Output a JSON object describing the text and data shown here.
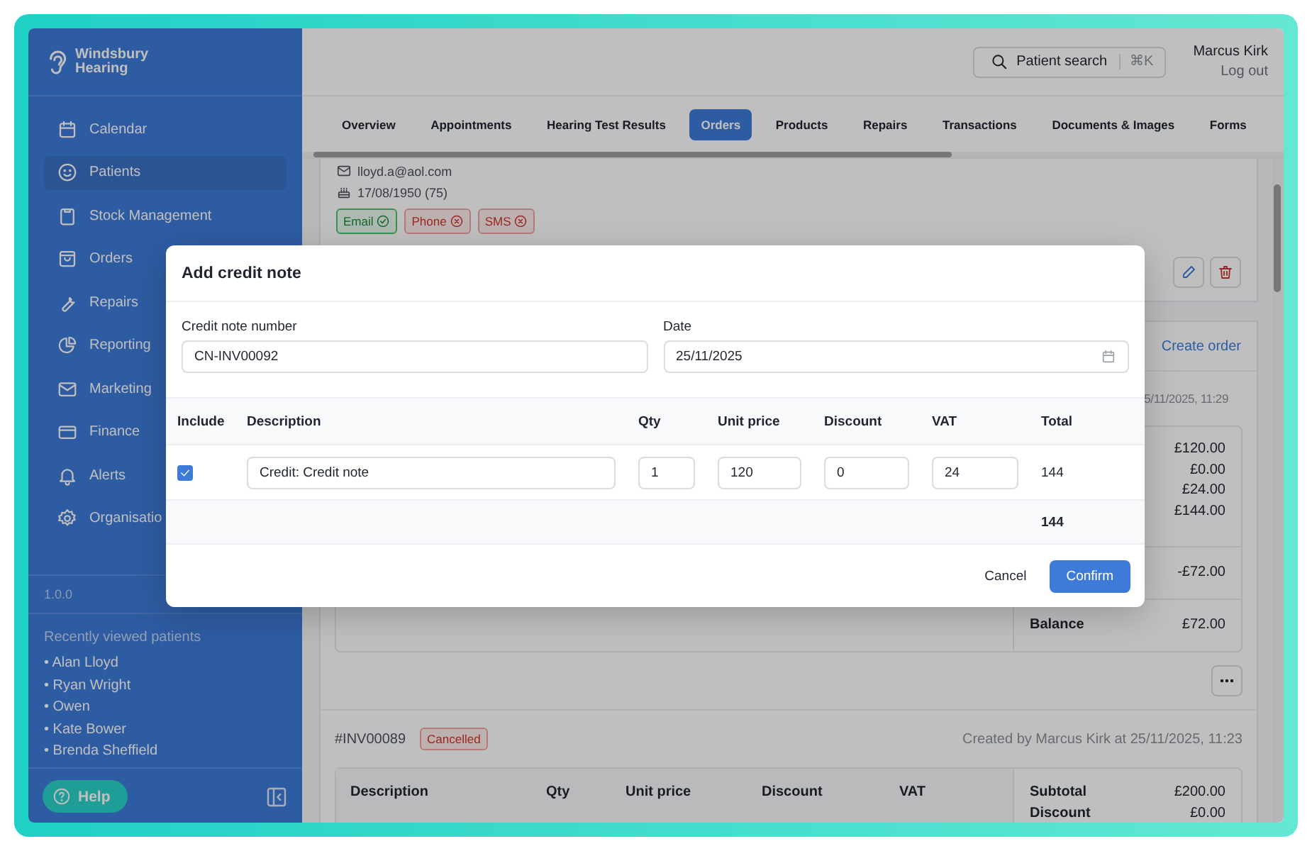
{
  "sidebar": {
    "logo": "Windsbury Hearing",
    "nav": [
      {
        "label": "Calendar",
        "selected": false
      },
      {
        "label": "Patients",
        "selected": true
      },
      {
        "label": "Stock Management",
        "selected": false
      },
      {
        "label": "Orders",
        "selected": false
      },
      {
        "label": "Repairs",
        "selected": false
      },
      {
        "label": "Reporting",
        "selected": false
      },
      {
        "label": "Marketing",
        "selected": false
      },
      {
        "label": "Finance",
        "selected": false
      },
      {
        "label": "Alerts",
        "selected": false
      },
      {
        "label": "Organisatio",
        "selected": false
      }
    ],
    "version": "1.0.0",
    "recent_title": "Recently viewed patients",
    "recent": [
      "• Alan Lloyd",
      "• Ryan Wright",
      "• Owen",
      "• Kate Bower",
      "• Brenda Sheffield"
    ],
    "help": "Help"
  },
  "header": {
    "search": {
      "label": "Patient search",
      "shortcut": "⌘K"
    },
    "user": "Marcus Kirk",
    "logout": "Log out"
  },
  "tabs": [
    {
      "label": "Overview",
      "selected": false
    },
    {
      "label": "Appointments",
      "selected": false
    },
    {
      "label": "Hearing Test Results",
      "selected": false
    },
    {
      "label": "Orders",
      "selected": true
    },
    {
      "label": "Products",
      "selected": false
    },
    {
      "label": "Repairs",
      "selected": false
    },
    {
      "label": "Transactions",
      "selected": false
    },
    {
      "label": "Documents & Images",
      "selected": false
    },
    {
      "label": "Forms",
      "selected": false
    }
  ],
  "patient": {
    "email": "lloyd.a@aol.com",
    "dob": "17/08/1950 (75)",
    "consents": [
      {
        "label": "Email",
        "allowed": true
      },
      {
        "label": "Phone",
        "allowed": false
      },
      {
        "label": "SMS",
        "allowed": false
      }
    ]
  },
  "orders": {
    "create": "Create order",
    "first": {
      "created": "5/11/2025, 11:29",
      "amounts": [
        "£120.00",
        "£0.00",
        "£24.00",
        "£144.00"
      ],
      "adjustment": "-£72.00",
      "balance_label": "Balance",
      "balance": "£72.00"
    },
    "second": {
      "number": "#INV00089",
      "status": "Cancelled",
      "created": "Created by Marcus Kirk at 25/11/2025, 11:23",
      "columns": [
        "Description",
        "Qty",
        "Unit price",
        "Discount",
        "VAT"
      ],
      "totals": [
        {
          "label": "Subtotal",
          "value": "£200.00"
        },
        {
          "label": "Discount",
          "value": "£0.00"
        }
      ]
    }
  },
  "modal": {
    "title": "Add credit note",
    "fields": [
      {
        "kind": "text",
        "label": "Credit note number",
        "value": "CN-INV00092"
      },
      {
        "kind": "date",
        "label": "Date",
        "value": "25/11/2025"
      }
    ],
    "columns": [
      "Include",
      "Description",
      "Qty",
      "Unit price",
      "Discount",
      "VAT",
      "Total"
    ],
    "rows": [
      {
        "checked": true,
        "description": "Credit: Credit note",
        "qty": "1",
        "unit_price": "120",
        "discount": "0",
        "vat": "24",
        "total": "144"
      }
    ],
    "total": "144",
    "cancel": "Cancel",
    "confirm": "Confirm"
  }
}
